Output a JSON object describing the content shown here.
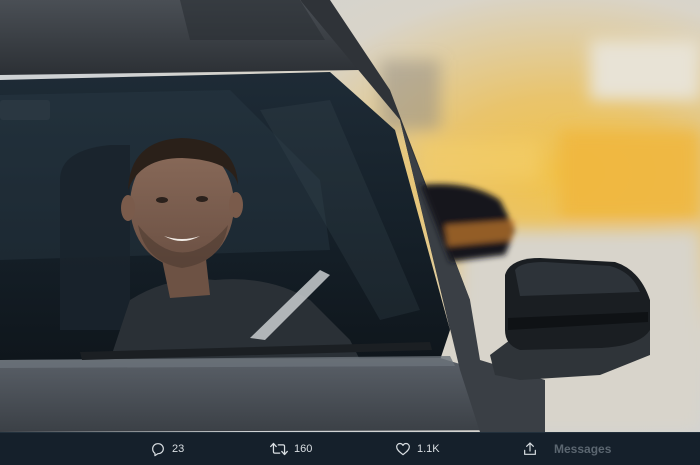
{
  "tweet": {
    "actions": {
      "reply": {
        "icon": "reply-icon",
        "count": "23"
      },
      "retweet": {
        "icon": "retweet-icon",
        "count": "160"
      },
      "like": {
        "icon": "heart-icon",
        "count": "1.1K"
      },
      "share": {
        "icon": "share-icon"
      }
    },
    "messages_label": "Messages"
  },
  "colors": {
    "background": "#15202b",
    "icon": "#d9dee2",
    "messages_text": "#5b6670"
  }
}
